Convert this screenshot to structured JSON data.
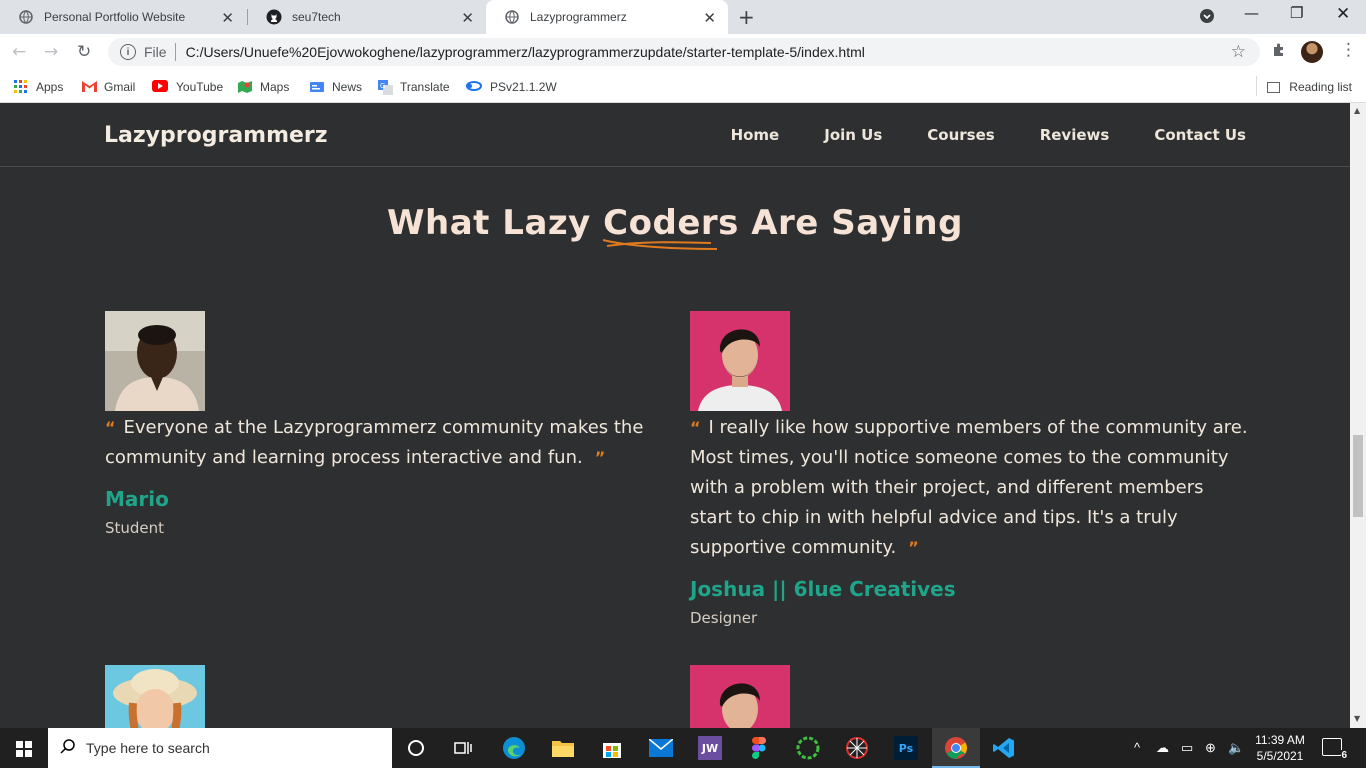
{
  "browser": {
    "tabs": [
      {
        "title": "Personal Portfolio Website",
        "active": false
      },
      {
        "title": "seu7tech",
        "active": false
      },
      {
        "title": "Lazyprogrammerz",
        "active": true
      }
    ],
    "address": {
      "scheme_label": "File",
      "url": "C:/Users/Unuefe%20Ejovwokoghene/lazyprogrammerz/lazyprogrammerzupdate/starter-template-5/index.html"
    },
    "bookmarks": [
      {
        "label": "Apps",
        "icon": "apps-grid-icon"
      },
      {
        "label": "Gmail",
        "icon": "gmail-icon"
      },
      {
        "label": "YouTube",
        "icon": "youtube-icon"
      },
      {
        "label": "Maps",
        "icon": "maps-icon"
      },
      {
        "label": "News",
        "icon": "news-icon"
      },
      {
        "label": "Translate",
        "icon": "translate-icon"
      },
      {
        "label": "PSv21.1.2W",
        "icon": "ps-icon"
      }
    ],
    "reading_list": "Reading list"
  },
  "site": {
    "brand": "Lazyprogrammerz",
    "nav": [
      "Home",
      "Join Us",
      "Courses",
      "Reviews",
      "Contact Us"
    ],
    "heading_pre": "What Lazy ",
    "heading_em": "Coders",
    "heading_post": " Are Saying",
    "testimonials": [
      {
        "quote": "Everyone at the Lazyprogrammerz community makes the community and learning process interactive and fun.",
        "name": "Mario",
        "role": "Student"
      },
      {
        "quote": "I really like how supportive members of the community are. Most times, you'll notice someone comes to the community with a problem with their project, and different members start to chip in with helpful advice and tips. It's a truly supportive community.",
        "name": "Joshua || 6lue Creatives",
        "role": "Designer"
      }
    ],
    "quote_open": "“",
    "quote_close": "”"
  },
  "colors": {
    "page_bg": "#2e2f31",
    "accent_orange": "#e07a1f",
    "accent_teal": "#1fa58a",
    "heading": "#f6e3d6"
  },
  "taskbar": {
    "search_placeholder": "Type here to search",
    "time": "11:39 AM",
    "date": "5/5/2021",
    "notifications": "6"
  }
}
